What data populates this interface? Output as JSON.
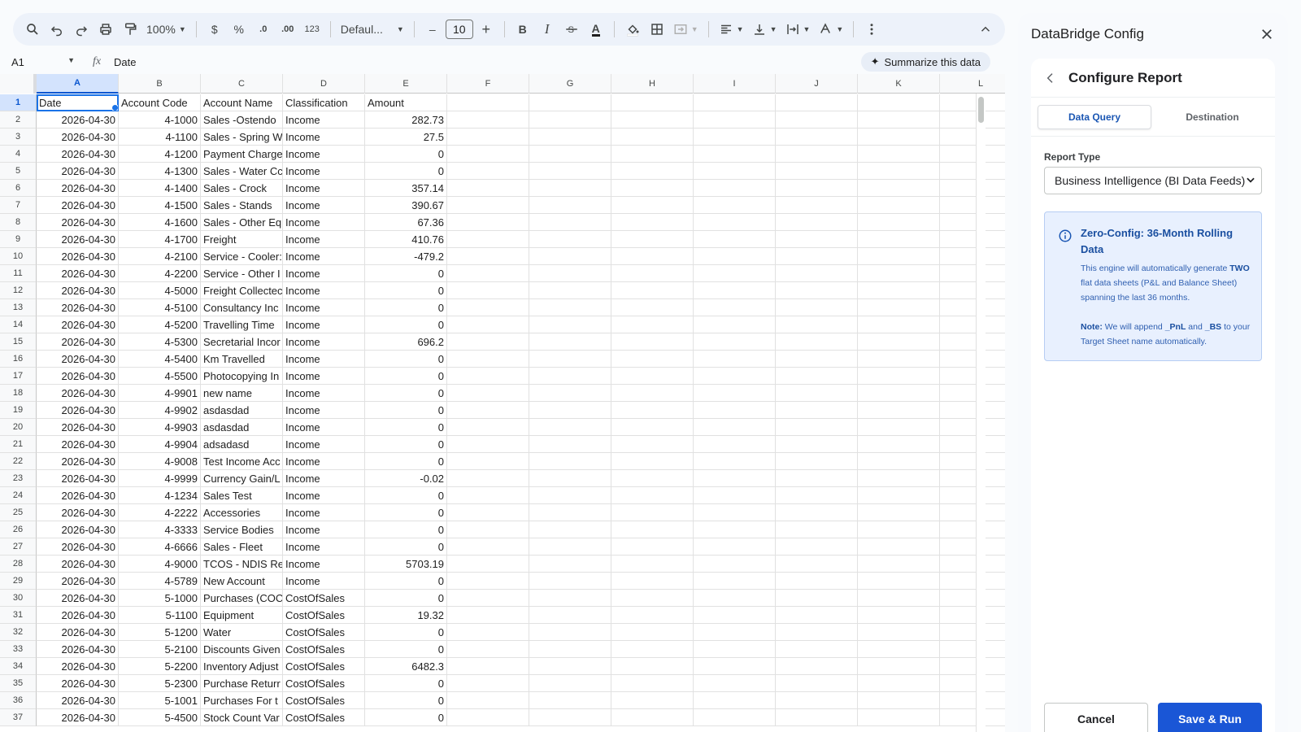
{
  "toolbar": {
    "zoom": "100%",
    "currency": "$",
    "percent": "%",
    "dec_decrease": ".0",
    "dec_increase": ".00",
    "format_123": "123",
    "font": "Defaul...",
    "font_size": "10",
    "minus": "–",
    "plus": "+",
    "bold": "B",
    "italic": "I",
    "text_color": "A"
  },
  "formula_bar": {
    "cell_ref": "A1",
    "value": "Date",
    "summarize": "Summarize this data"
  },
  "sheet": {
    "columns": [
      "A",
      "B",
      "C",
      "D",
      "E",
      "F",
      "G",
      "H",
      "I",
      "J",
      "K",
      "L"
    ],
    "rows": [
      {
        "n": "1",
        "date": "Date",
        "code": "Account Code",
        "name": "Account Name",
        "cls": "Classification",
        "amt": "Amount"
      },
      {
        "n": "2",
        "date": "2026-04-30",
        "code": "4-1000",
        "name": "Sales -Ostendo",
        "cls": "Income",
        "amt": "282.73"
      },
      {
        "n": "3",
        "date": "2026-04-30",
        "code": "4-1100",
        "name": "Sales - Spring W",
        "cls": "Income",
        "amt": "27.5"
      },
      {
        "n": "4",
        "date": "2026-04-30",
        "code": "4-1200",
        "name": "Payment Charge",
        "cls": "Income",
        "amt": "0"
      },
      {
        "n": "5",
        "date": "2026-04-30",
        "code": "4-1300",
        "name": "Sales - Water Cc",
        "cls": "Income",
        "amt": "0"
      },
      {
        "n": "6",
        "date": "2026-04-30",
        "code": "4-1400",
        "name": "Sales - Crock",
        "cls": "Income",
        "amt": "357.14"
      },
      {
        "n": "7",
        "date": "2026-04-30",
        "code": "4-1500",
        "name": "Sales - Stands",
        "cls": "Income",
        "amt": "390.67"
      },
      {
        "n": "8",
        "date": "2026-04-30",
        "code": "4-1600",
        "name": "Sales - Other Eq",
        "cls": "Income",
        "amt": "67.36"
      },
      {
        "n": "9",
        "date": "2026-04-30",
        "code": "4-1700",
        "name": "Freight",
        "cls": "Income",
        "amt": "410.76"
      },
      {
        "n": "10",
        "date": "2026-04-30",
        "code": "4-2100",
        "name": "Service - Cooler:",
        "cls": "Income",
        "amt": "-479.2"
      },
      {
        "n": "11",
        "date": "2026-04-30",
        "code": "4-2200",
        "name": "Service - Other I",
        "cls": "Income",
        "amt": "0"
      },
      {
        "n": "12",
        "date": "2026-04-30",
        "code": "4-5000",
        "name": "Freight Collectec",
        "cls": "Income",
        "amt": "0"
      },
      {
        "n": "13",
        "date": "2026-04-30",
        "code": "4-5100",
        "name": "Consultancy Inc",
        "cls": "Income",
        "amt": "0"
      },
      {
        "n": "14",
        "date": "2026-04-30",
        "code": "4-5200",
        "name": "Travelling Time",
        "cls": "Income",
        "amt": "0"
      },
      {
        "n": "15",
        "date": "2026-04-30",
        "code": "4-5300",
        "name": "Secretarial Incor",
        "cls": "Income",
        "amt": "696.2"
      },
      {
        "n": "16",
        "date": "2026-04-30",
        "code": "4-5400",
        "name": "Km Travelled",
        "cls": "Income",
        "amt": "0"
      },
      {
        "n": "17",
        "date": "2026-04-30",
        "code": "4-5500",
        "name": "Photocopying In",
        "cls": "Income",
        "amt": "0"
      },
      {
        "n": "18",
        "date": "2026-04-30",
        "code": "4-9901",
        "name": "new name",
        "cls": "Income",
        "amt": "0"
      },
      {
        "n": "19",
        "date": "2026-04-30",
        "code": "4-9902",
        "name": "asdasdad",
        "cls": "Income",
        "amt": "0"
      },
      {
        "n": "20",
        "date": "2026-04-30",
        "code": "4-9903",
        "name": "asdasdad",
        "cls": "Income",
        "amt": "0"
      },
      {
        "n": "21",
        "date": "2026-04-30",
        "code": "4-9904",
        "name": "adsadasd",
        "cls": "Income",
        "amt": "0"
      },
      {
        "n": "22",
        "date": "2026-04-30",
        "code": "4-9008",
        "name": "Test Income Acc",
        "cls": "Income",
        "amt": "0"
      },
      {
        "n": "23",
        "date": "2026-04-30",
        "code": "4-9999",
        "name": "Currency Gain/L",
        "cls": "Income",
        "amt": "-0.02"
      },
      {
        "n": "24",
        "date": "2026-04-30",
        "code": "4-1234",
        "name": "Sales Test",
        "cls": "Income",
        "amt": "0"
      },
      {
        "n": "25",
        "date": "2026-04-30",
        "code": "4-2222",
        "name": "Accessories",
        "cls": "Income",
        "amt": "0"
      },
      {
        "n": "26",
        "date": "2026-04-30",
        "code": "4-3333",
        "name": "Service Bodies",
        "cls": "Income",
        "amt": "0"
      },
      {
        "n": "27",
        "date": "2026-04-30",
        "code": "4-6666",
        "name": "Sales - Fleet",
        "cls": "Income",
        "amt": "0"
      },
      {
        "n": "28",
        "date": "2026-04-30",
        "code": "4-9000",
        "name": "TCOS - NDIS Re",
        "cls": "Income",
        "amt": "5703.19"
      },
      {
        "n": "29",
        "date": "2026-04-30",
        "code": "4-5789",
        "name": "New Account",
        "cls": "Income",
        "amt": "0"
      },
      {
        "n": "30",
        "date": "2026-04-30",
        "code": "5-1000",
        "name": "Purchases (COC",
        "cls": "CostOfSales",
        "amt": "0"
      },
      {
        "n": "31",
        "date": "2026-04-30",
        "code": "5-1100",
        "name": "Equipment",
        "cls": "CostOfSales",
        "amt": "19.32"
      },
      {
        "n": "32",
        "date": "2026-04-30",
        "code": "5-1200",
        "name": "Water",
        "cls": "CostOfSales",
        "amt": "0"
      },
      {
        "n": "33",
        "date": "2026-04-30",
        "code": "5-2100",
        "name": "Discounts Given",
        "cls": "CostOfSales",
        "amt": "0"
      },
      {
        "n": "34",
        "date": "2026-04-30",
        "code": "5-2200",
        "name": "Inventory Adjust",
        "cls": "CostOfSales",
        "amt": "6482.3"
      },
      {
        "n": "35",
        "date": "2026-04-30",
        "code": "5-2300",
        "name": "Purchase Returr",
        "cls": "CostOfSales",
        "amt": "0"
      },
      {
        "n": "36",
        "date": "2026-04-30",
        "code": "5-1001",
        "name": "Purchases For t",
        "cls": "CostOfSales",
        "amt": "0"
      },
      {
        "n": "37",
        "date": "2026-04-30",
        "code": "5-4500",
        "name": "Stock Count Var",
        "cls": "CostOfSales",
        "amt": "0"
      }
    ]
  },
  "sidebar": {
    "title": "DataBridge Config",
    "card_title": "Configure Report",
    "tabs": [
      {
        "label": "Data Query",
        "active": true
      },
      {
        "label": "Destination",
        "active": false
      }
    ],
    "report_type_label": "Report Type",
    "report_type_value": "Business Intelligence (BI Data Feeds)",
    "info": {
      "title": "Zero-Config: 36-Month Rolling Data",
      "body_pre": "This engine will automatically generate ",
      "body_strong": "TWO",
      "body_post": " flat data sheets (P&L and Balance Sheet) spanning the last 36 months.",
      "note_label": "Note:",
      "note_pre": " We will append ",
      "note_pnl": "_PnL",
      "note_and": " and ",
      "note_bs": "_BS",
      "note_post": " to your Target Sheet name automatically."
    },
    "cancel": "Cancel",
    "save": "Save & Run"
  },
  "colors": {
    "accent": "#1a73e8",
    "primary_button": "#1a56d6",
    "info_bg": "#e8f0fe"
  }
}
